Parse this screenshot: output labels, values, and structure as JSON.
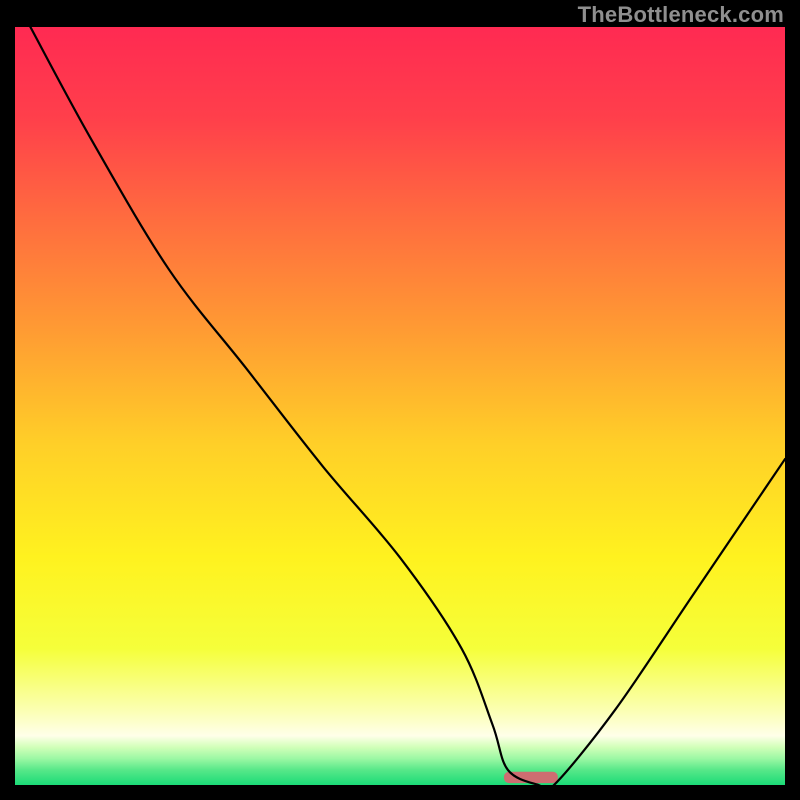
{
  "watermark": "TheBottleneck.com",
  "chart_data": {
    "type": "line",
    "title": "",
    "xlabel": "",
    "ylabel": "",
    "xlim": [
      0,
      100
    ],
    "ylim": [
      0,
      100
    ],
    "grid": false,
    "series": [
      {
        "name": "bottleneck-curve",
        "x": [
          2,
          10,
          20,
          30,
          40,
          50,
          58,
          62,
          64,
          68,
          70,
          78,
          88,
          100
        ],
        "values": [
          100,
          85,
          68,
          55,
          42,
          30,
          18,
          8,
          2,
          0,
          0,
          10,
          25,
          43
        ]
      }
    ],
    "marker": {
      "name": "optimal-indicator",
      "x_center": 67,
      "y_center": 1,
      "width": 7,
      "height": 1.5,
      "color": "#ce6d71"
    },
    "background_gradient": {
      "stops": [
        {
          "pos": 0.0,
          "color": "#ff2a52"
        },
        {
          "pos": 0.12,
          "color": "#ff3f4b"
        },
        {
          "pos": 0.25,
          "color": "#ff6b3f"
        },
        {
          "pos": 0.4,
          "color": "#ff9b33"
        },
        {
          "pos": 0.55,
          "color": "#ffcf28"
        },
        {
          "pos": 0.7,
          "color": "#fff21f"
        },
        {
          "pos": 0.82,
          "color": "#f5ff3a"
        },
        {
          "pos": 0.9,
          "color": "#fbffb0"
        },
        {
          "pos": 0.935,
          "color": "#ffffe9"
        },
        {
          "pos": 0.95,
          "color": "#d2ffb9"
        },
        {
          "pos": 0.965,
          "color": "#9cf8a4"
        },
        {
          "pos": 0.98,
          "color": "#58e889"
        },
        {
          "pos": 1.0,
          "color": "#1bdb77"
        }
      ]
    }
  }
}
